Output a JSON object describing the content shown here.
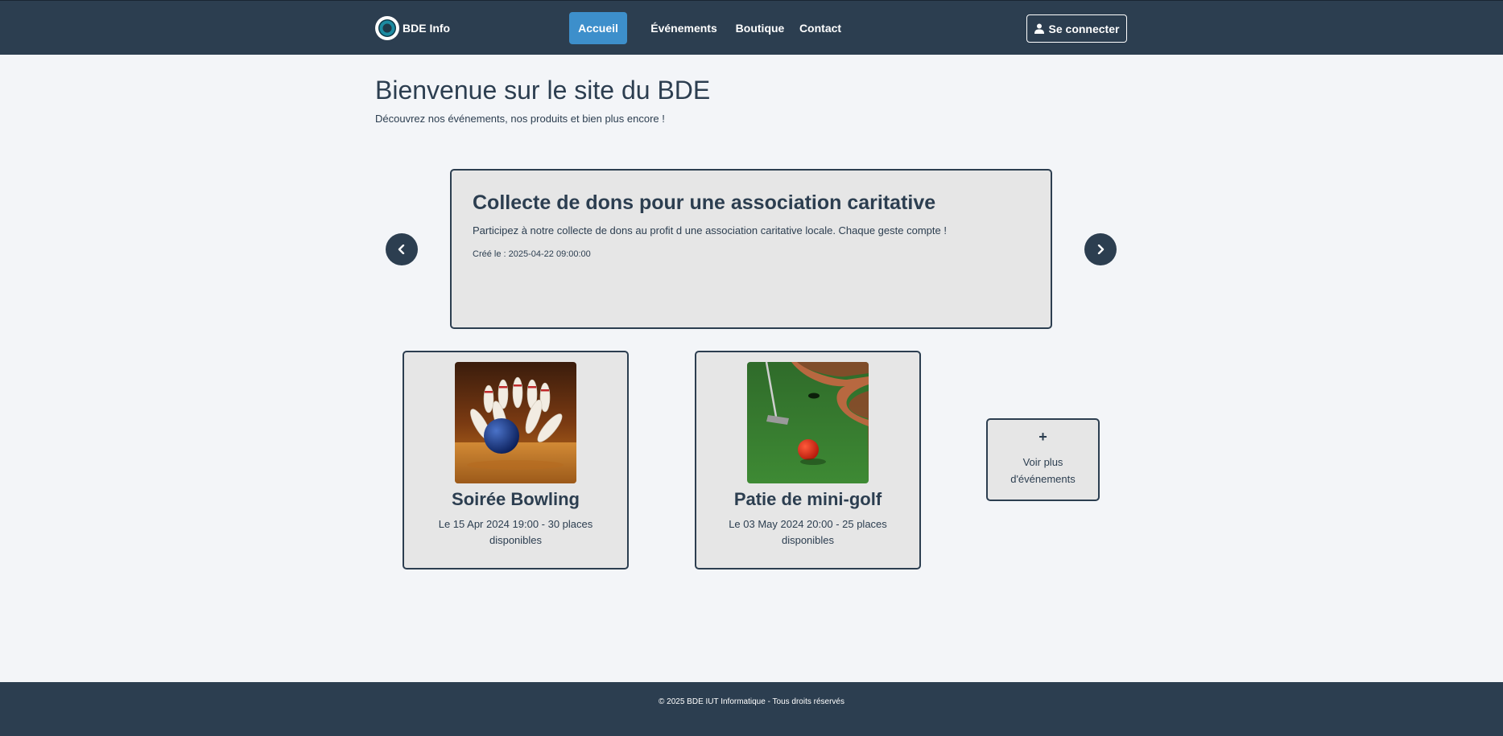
{
  "nav": {
    "brand": "BDE Info",
    "links": [
      "Accueil",
      "Événements",
      "Boutique",
      "Contact"
    ],
    "login_label": "Se connecter"
  },
  "header": {
    "title": "Bienvenue sur le site du BDE",
    "subtitle": "Découvrez nos événements, nos produits et bien plus encore !"
  },
  "carousel": {
    "title": "Collecte de dons pour une association caritative",
    "description": "Participez à notre collecte de dons au profit d une association caritative locale. Chaque geste compte !",
    "created": "Créé le : 2025-04-22 09:00:00"
  },
  "events": [
    {
      "title": "Soirée Bowling",
      "info": "Le 15 Apr 2024 19:00 - 30 places disponibles",
      "image": "bowling-pins-photo"
    },
    {
      "title": "Patie de mini-golf",
      "info": "Le 03 May 2024 20:00 - 25 places disponibles",
      "image": "mini-golf-photo"
    }
  ],
  "more": {
    "plus": "+",
    "label": "Voir plus d'événements"
  },
  "footer": {
    "text": "© 2025 BDE IUT Informatique - Tous droits réservés"
  },
  "colors": {
    "primary": "#2c3e50",
    "accent": "#3d8fcb",
    "card_bg": "#e6e6e6",
    "page_bg": "#f3f5f8"
  }
}
